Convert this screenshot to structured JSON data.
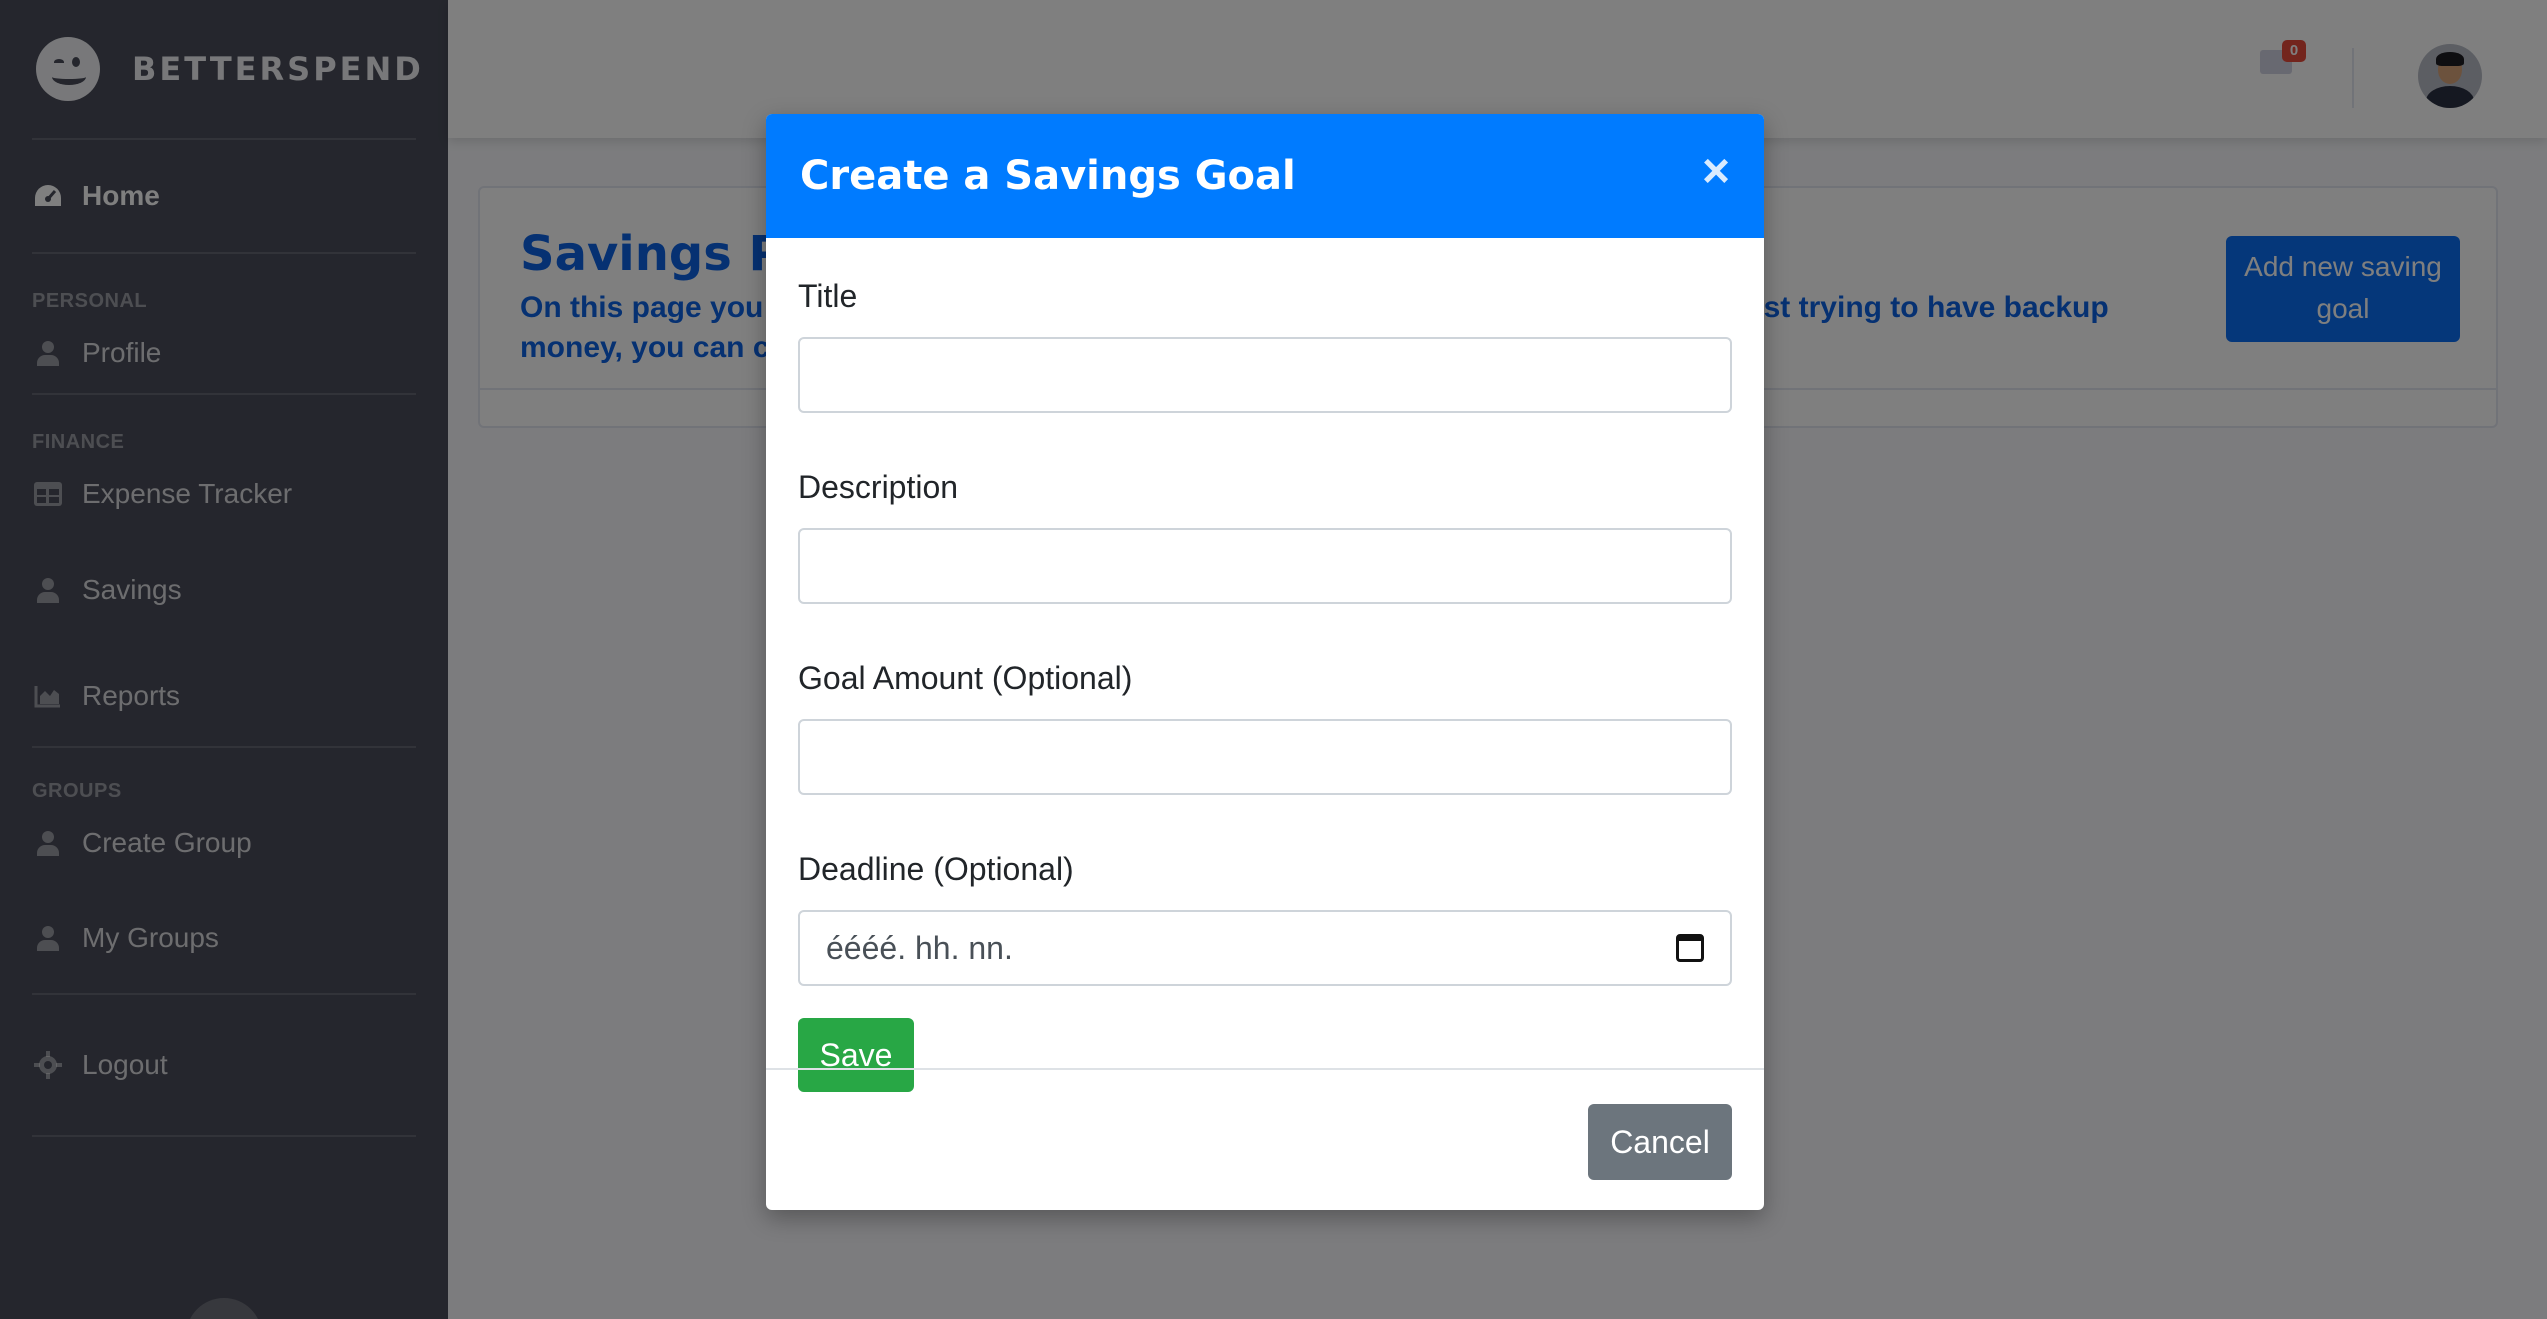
{
  "brand": {
    "name": "BETTERSPEND"
  },
  "sidebar": {
    "home": "Home",
    "sections": [
      {
        "heading": "PERSONAL",
        "items": [
          "Profile"
        ]
      },
      {
        "heading": "FINANCE",
        "items": [
          "Expense Tracker",
          "Savings",
          "Reports"
        ]
      },
      {
        "heading": "GROUPS",
        "items": [
          "Create Group",
          "My Groups"
        ]
      }
    ],
    "logout": "Logout"
  },
  "topbar": {
    "alerts_count": "0"
  },
  "page": {
    "title": "Savings Page",
    "subtitle": "On this page you can create savings goals. Whether you are saving for something or just trying to have backup money, you can create a goal here.",
    "add_button": "Add new saving goal"
  },
  "modal": {
    "title": "Create a Savings Goal",
    "close": "×",
    "fields": {
      "title_label": "Title",
      "description_label": "Description",
      "goal_label": "Goal Amount (Optional)",
      "deadline_label": "Deadline (Optional)",
      "deadline_placeholder": "éééé. hh. nn."
    },
    "save": "Save",
    "cancel": "Cancel"
  },
  "colors": {
    "primary": "#007bff",
    "success": "#28a745",
    "secondary": "#6c757d",
    "sidebar": "#4a4d5a",
    "accent_text": "#0c63e4"
  }
}
